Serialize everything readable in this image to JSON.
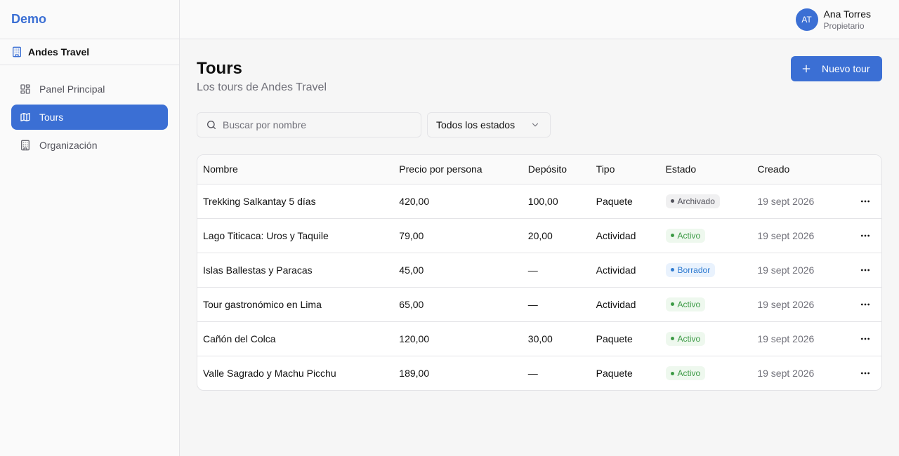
{
  "sidebar": {
    "brand": "Demo",
    "organization": "Andes Travel",
    "items": [
      {
        "label": "Panel Principal",
        "icon": "dashboard-icon",
        "active": false
      },
      {
        "label": "Tours",
        "icon": "map-icon",
        "active": true
      },
      {
        "label": "Organización",
        "icon": "building-icon",
        "active": false
      }
    ]
  },
  "header": {
    "user": {
      "initials": "AT",
      "name": "Ana Torres",
      "role": "Propietario"
    }
  },
  "main": {
    "title": "Tours",
    "subtitle": "Los tours de Andes Travel",
    "new_button_label": "Nuevo tour",
    "search": {
      "placeholder": "Buscar por nombre",
      "value": ""
    },
    "status_filter": {
      "selected": "Todos los estados"
    },
    "table": {
      "columns": [
        "Nombre",
        "Precio por persona",
        "Depósito",
        "Tipo",
        "Estado",
        "Creado"
      ],
      "rows": [
        {
          "name": "Trekking Salkantay 5 días",
          "price": "420,00",
          "deposit": "100,00",
          "type": "Paquete",
          "status": "Archivado",
          "status_style": "gray",
          "created": "19 sept 2026"
        },
        {
          "name": "Lago Titicaca: Uros y Taquile",
          "price": "79,00",
          "deposit": "20,00",
          "type": "Actividad",
          "status": "Activo",
          "status_style": "green",
          "created": "19 sept 2026"
        },
        {
          "name": "Islas Ballestas y Paracas",
          "price": "45,00",
          "deposit": "—",
          "type": "Actividad",
          "status": "Borrador",
          "status_style": "blue",
          "created": "19 sept 2026"
        },
        {
          "name": "Tour gastronómico en Lima",
          "price": "65,00",
          "deposit": "—",
          "type": "Actividad",
          "status": "Activo",
          "status_style": "green",
          "created": "19 sept 2026"
        },
        {
          "name": "Cañón del Colca",
          "price": "120,00",
          "deposit": "30,00",
          "type": "Paquete",
          "status": "Activo",
          "status_style": "green",
          "created": "19 sept 2026"
        },
        {
          "name": "Valle Sagrado y Machu Picchu",
          "price": "189,00",
          "deposit": "—",
          "type": "Paquete",
          "status": "Activo",
          "status_style": "green",
          "created": "19 sept 2026"
        }
      ]
    }
  },
  "colors": {
    "accent": "#3b6fd4",
    "status_gray": "#52525b",
    "status_green": "#3c9a45",
    "status_blue": "#2f7bd0"
  }
}
